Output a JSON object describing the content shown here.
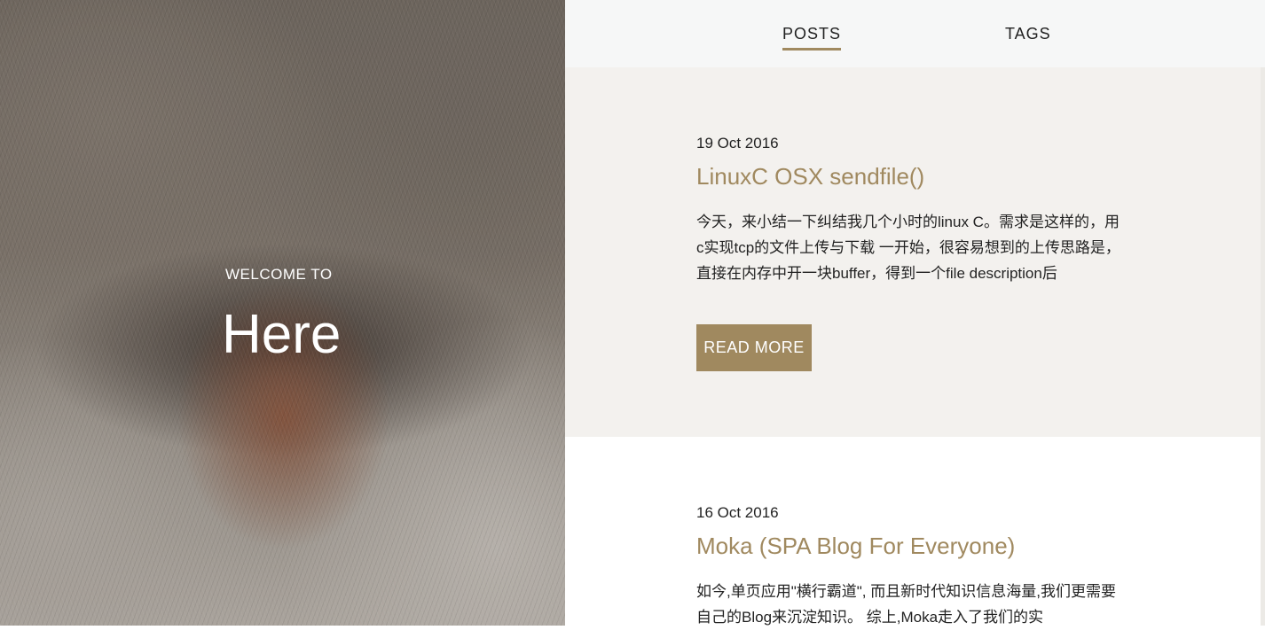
{
  "hero": {
    "welcome": "WELCOME TO",
    "title": "Here"
  },
  "nav": {
    "tabs": [
      {
        "label": "POSTS",
        "active": true
      },
      {
        "label": "TAGS",
        "active": false
      }
    ],
    "accent": "#a0895f"
  },
  "posts": [
    {
      "date": "19 Oct 2016",
      "title": "LinuxC OSX sendfile()",
      "excerpt": "今天，来小结一下纠结我几个小时的linux C。需求是这样的，用c实现tcp的文件上传与下载 一开始，很容易想到的上传思路是，直接在内存中开一块buffer，得到一个file description后",
      "read_more": "READ MORE"
    },
    {
      "date": "16 Oct 2016",
      "title": "Moka (SPA Blog For Everyone)",
      "excerpt": "如今,单页应用\"横行霸道\", 而且新时代知识信息海量,我们更需要自己的Blog来沉淀知识。 综上,Moka走入了我们的实"
    }
  ]
}
